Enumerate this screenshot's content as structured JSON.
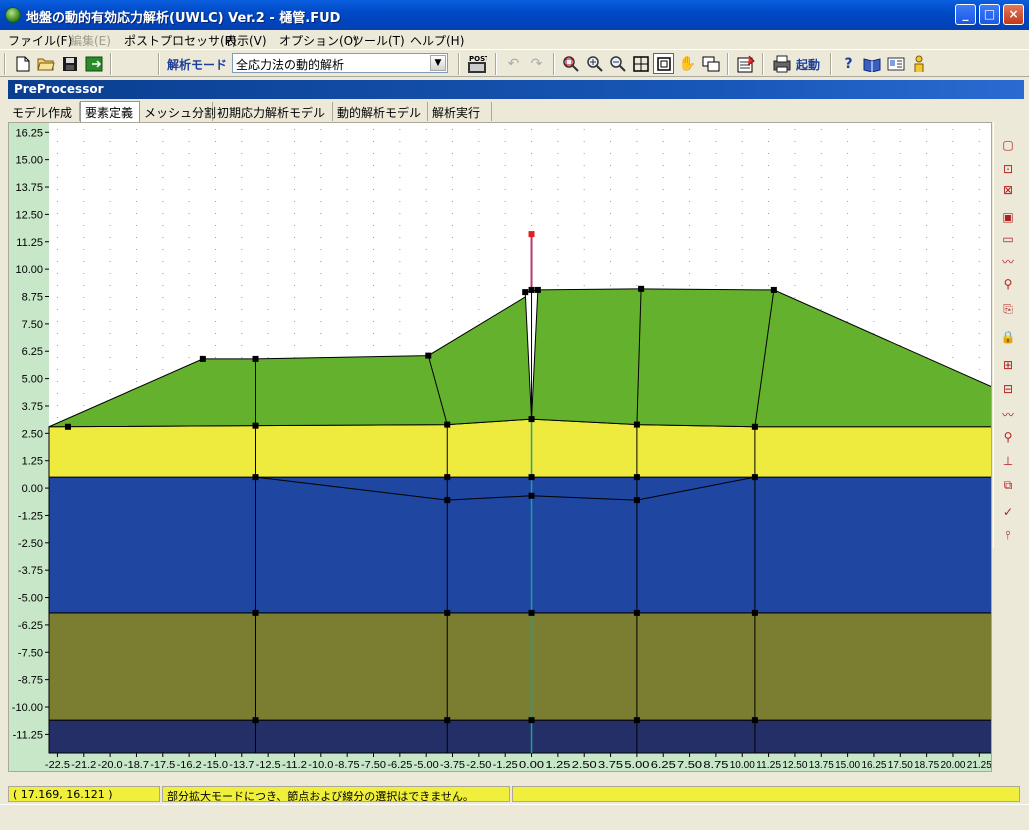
{
  "window": {
    "title": "地盤の動的有効応力解析(UWLC) Ver.2 - 樋管.FUD",
    "buttons": {
      "minimize": "_",
      "maximize": "□",
      "close": "×"
    }
  },
  "menu": [
    {
      "label": "ファイル(F)",
      "enabled": true
    },
    {
      "label": "編集(E)",
      "enabled": false
    },
    {
      "label": "ポストプロセッサ(P)",
      "enabled": true
    },
    {
      "label": "表示(V)",
      "enabled": true
    },
    {
      "label": "オプション(O)",
      "enabled": true
    },
    {
      "label": "ツール(T)",
      "enabled": true
    },
    {
      "label": "ヘルプ(H)",
      "enabled": true
    }
  ],
  "toolbar": {
    "mode_label": "解析モード",
    "mode_value": "全応力法の動的解析",
    "post_label": "POST",
    "run_label": "起動"
  },
  "panel": {
    "title": "PreProcessor"
  },
  "tabs": [
    {
      "label": "モデル作成",
      "active": false
    },
    {
      "label": "要素定義",
      "active": true
    },
    {
      "label": "メッシュ分割",
      "active": false
    },
    {
      "label": "初期応力解析モデル",
      "active": false
    },
    {
      "label": "動的解析モデル",
      "active": false
    },
    {
      "label": "解析実行",
      "active": false
    }
  ],
  "chart_data": {
    "type": "area",
    "x_ticks": [
      "-22.5",
      "-21.2",
      "-20.0",
      "-18.7",
      "-17.5",
      "-16.2",
      "-15.0",
      "-13.7",
      "-12.5",
      "-11.2",
      "-10.0",
      "-8.75",
      "-7.50",
      "-6.25",
      "-5.00",
      "-3.75",
      "-2.50",
      "-1.25",
      "0.00",
      "1.25",
      "2.50",
      "3.75",
      "5.00",
      "6.25",
      "7.50",
      "8.75",
      "10.00",
      "11.25",
      "12.50",
      "13.75",
      "15.00",
      "16.25",
      "17.50",
      "18.75",
      "20.00",
      "21.25"
    ],
    "y_ticks": [
      "16.25",
      "15.00",
      "13.75",
      "12.50",
      "11.25",
      "10.00",
      "8.75",
      "7.50",
      "6.25",
      "5.00",
      "3.75",
      "2.50",
      "1.25",
      "0.00",
      "-1.25",
      "-2.50",
      "-3.75",
      "-5.00",
      "-6.25",
      "-7.50",
      "-8.75",
      "-10.00",
      "-11.25"
    ],
    "xlim": [
      -22.9,
      21.9
    ],
    "ylim": [
      -12.1,
      16.4
    ],
    "grid": "dotted",
    "layers": [
      {
        "color": "#232f66",
        "polygon": [
          [
            -22.9,
            -10.6
          ],
          [
            21.9,
            -10.6
          ],
          [
            21.9,
            -12.1
          ],
          [
            -22.9,
            -12.1
          ]
        ]
      },
      {
        "color": "#7b7d31",
        "polygon": [
          [
            -22.9,
            -5.7
          ],
          [
            21.9,
            -5.7
          ],
          [
            21.9,
            -10.6
          ],
          [
            -22.9,
            -10.6
          ]
        ]
      },
      {
        "color": "#1f46a0",
        "polygon": [
          [
            -22.9,
            0.5
          ],
          [
            21.9,
            0.5
          ],
          [
            21.9,
            -5.7
          ],
          [
            -22.9,
            -5.7
          ]
        ]
      },
      {
        "color": "#eeea3e",
        "polygon": [
          [
            -22.9,
            2.8
          ],
          [
            -4.0,
            2.9
          ],
          [
            0.0,
            3.15
          ],
          [
            5.0,
            2.9
          ],
          [
            10.6,
            2.8
          ],
          [
            21.9,
            2.8
          ],
          [
            21.9,
            0.5
          ],
          [
            -22.9,
            0.5
          ]
        ]
      },
      {
        "color": "#64b12e",
        "polygon": [
          [
            -22.9,
            2.8
          ],
          [
            -15.6,
            5.9
          ],
          [
            -13.1,
            5.9
          ],
          [
            -4.9,
            6.05
          ],
          [
            0.0,
            8.9
          ],
          [
            0.3,
            9.05
          ],
          [
            5.0,
            9.1
          ],
          [
            11.5,
            9.05
          ],
          [
            21.9,
            4.6
          ],
          [
            21.9,
            2.8
          ],
          [
            10.6,
            2.8
          ],
          [
            5.0,
            2.9
          ],
          [
            0.0,
            3.15
          ],
          [
            -4.0,
            2.9
          ]
        ]
      }
    ],
    "gap_wedge": [
      [
        -0.3,
        8.95
      ],
      [
        0.0,
        3.15
      ],
      [
        0.3,
        9.05
      ]
    ],
    "lines": [
      [
        [
          -13.1,
          5.9
        ],
        [
          -13.1,
          -12.1
        ]
      ],
      [
        [
          -4.9,
          6.05
        ],
        [
          -4.0,
          2.9
        ]
      ],
      [
        [
          -4.0,
          2.9
        ],
        [
          -4.0,
          -12.1
        ]
      ],
      [
        [
          0.0,
          3.15
        ],
        [
          0.0,
          8.95
        ]
      ],
      [
        [
          5.2,
          9.1
        ],
        [
          5.0,
          2.9
        ]
      ],
      [
        [
          5.0,
          2.9
        ],
        [
          5.0,
          -12.1
        ]
      ],
      [
        [
          11.5,
          9.05
        ],
        [
          10.6,
          2.8
        ]
      ],
      [
        [
          10.6,
          2.8
        ],
        [
          10.6,
          -12.1
        ]
      ],
      [
        [
          -13.1,
          0.5
        ],
        [
          -4.0,
          -0.55
        ],
        [
          0.0,
          -0.35
        ],
        [
          5.0,
          -0.55
        ],
        [
          10.6,
          0.5
        ]
      ]
    ],
    "nodes": [
      [
        -22.0,
        2.8
      ],
      [
        -15.6,
        5.9
      ],
      [
        -13.1,
        5.9
      ],
      [
        -4.9,
        6.05
      ],
      [
        -0.3,
        8.95
      ],
      [
        0.0,
        9.05
      ],
      [
        0.3,
        9.05
      ],
      [
        5.2,
        9.1
      ],
      [
        11.5,
        9.05
      ],
      [
        -13.1,
        2.85
      ],
      [
        -4.0,
        2.9
      ],
      [
        0.0,
        3.15
      ],
      [
        5.0,
        2.9
      ],
      [
        10.6,
        2.8
      ],
      [
        -13.1,
        0.5
      ],
      [
        -4.0,
        0.5
      ],
      [
        0.0,
        0.5
      ],
      [
        5.0,
        0.5
      ],
      [
        10.6,
        0.5
      ],
      [
        -4.0,
        -0.55
      ],
      [
        0.0,
        -0.35
      ],
      [
        5.0,
        -0.55
      ],
      [
        -13.1,
        -5.7
      ],
      [
        -4.0,
        -5.7
      ],
      [
        0.0,
        -5.7
      ],
      [
        5.0,
        -5.7
      ],
      [
        10.6,
        -5.7
      ],
      [
        -13.1,
        -10.6
      ],
      [
        -4.0,
        -10.6
      ],
      [
        0.0,
        -10.6
      ],
      [
        5.0,
        -10.6
      ],
      [
        10.6,
        -10.6
      ]
    ],
    "rod": {
      "x": 0.0,
      "y_top": 11.6,
      "y_bottom": 9.05,
      "color": "#b03a7a",
      "tip_color": "#e02020"
    },
    "axis_line": {
      "x": 0.0,
      "color": "#1aa0a0"
    }
  },
  "status": {
    "coords": "( 17.169, 16.121 )",
    "message": "部分拡大モードにつき、節点および線分の選択はできません。",
    "extra": ""
  },
  "palette_icons": [
    "rect-select-icon",
    "node-add-icon",
    "node-move-icon",
    "region-icon",
    "element-icon",
    "boundary-icon",
    "spring-icon",
    "property-copy-icon",
    "lock-icon",
    "grid-assign-icon",
    "grid-assign-2-icon",
    "load-icon",
    "load-node-icon",
    "fix-icon",
    "copy-icon",
    "check-icon",
    "rod-icon"
  ]
}
